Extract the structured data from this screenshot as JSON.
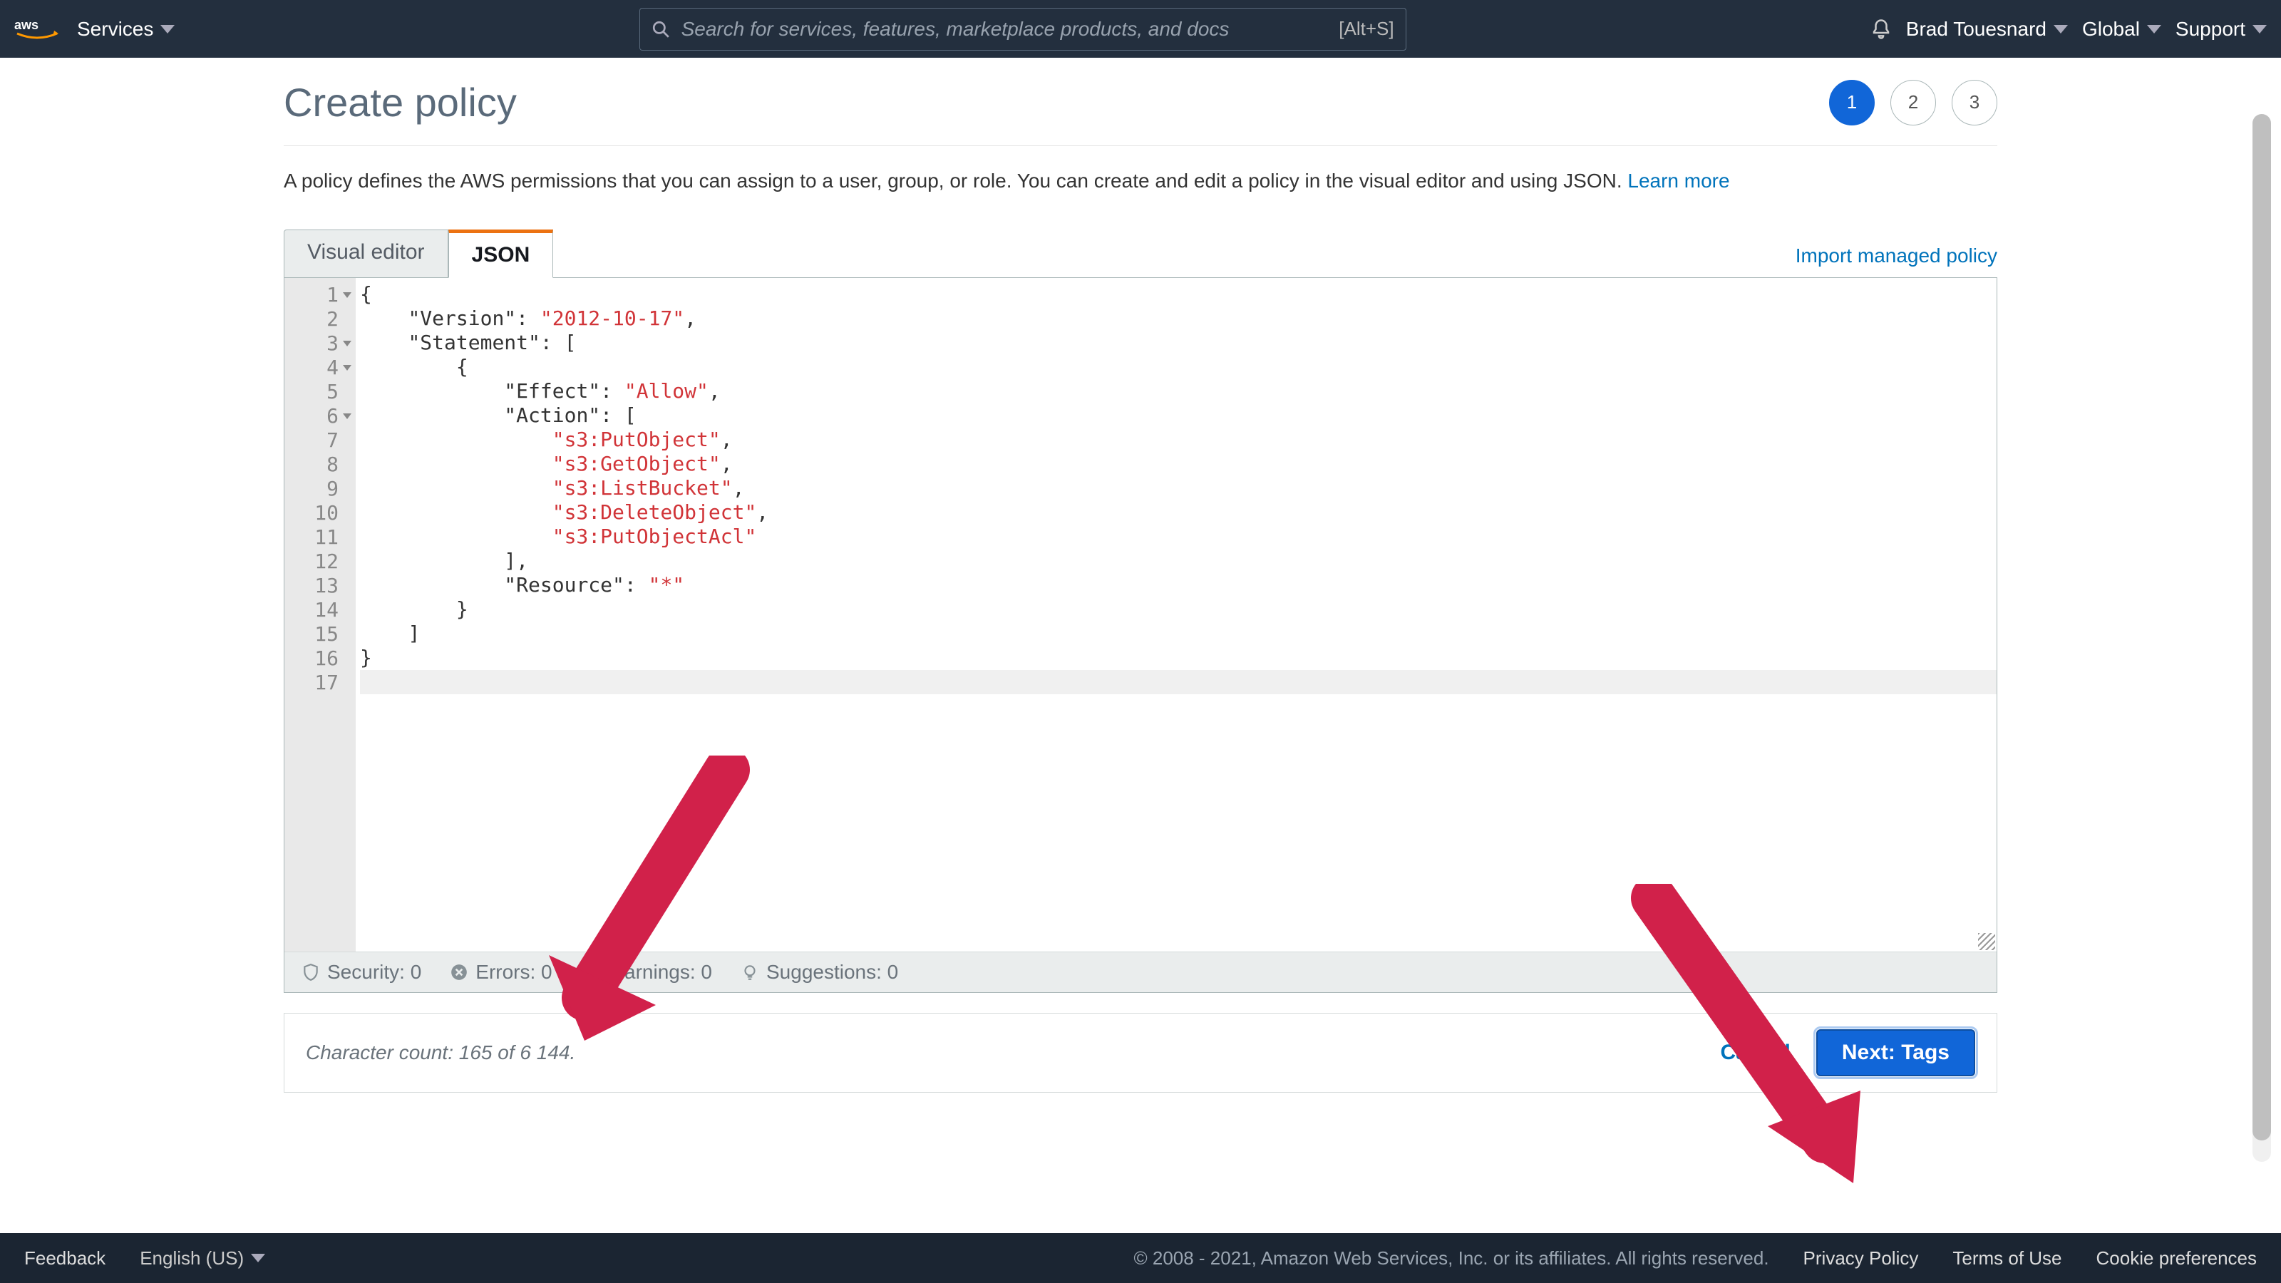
{
  "nav": {
    "services": "Services",
    "search_placeholder": "Search for services, features, marketplace products, and docs",
    "search_kbd": "[Alt+S]",
    "user": "Brad Touesnard",
    "region": "Global",
    "support": "Support"
  },
  "page": {
    "title": "Create policy",
    "desc_pre": "A policy defines the AWS permissions that you can assign to a user, group, or role. You can create and edit a policy in the visual editor and using JSON. ",
    "learn_more": "Learn more"
  },
  "steps": [
    "1",
    "2",
    "3"
  ],
  "tabs": {
    "visual": "Visual editor",
    "json": "JSON"
  },
  "import_link": "Import managed policy",
  "code": {
    "lines": [
      {
        "n": 1,
        "fold": true,
        "html": "{"
      },
      {
        "n": 2,
        "fold": false,
        "html": "    <span class='s-k'>\"Version\"</span><span class='s-p'>: </span><span class='s-str'>\"2012-10-17\"</span><span class='s-p'>,</span>"
      },
      {
        "n": 3,
        "fold": true,
        "html": "    <span class='s-k'>\"Statement\"</span><span class='s-p'>: [</span>"
      },
      {
        "n": 4,
        "fold": true,
        "html": "        <span class='s-p'>{</span>"
      },
      {
        "n": 5,
        "fold": false,
        "html": "            <span class='s-k'>\"Effect\"</span><span class='s-p'>: </span><span class='s-str'>\"Allow\"</span><span class='s-p'>,</span>"
      },
      {
        "n": 6,
        "fold": true,
        "html": "            <span class='s-k'>\"Action\"</span><span class='s-p'>: [</span>"
      },
      {
        "n": 7,
        "fold": false,
        "html": "                <span class='s-str'>\"s3:PutObject\"</span><span class='s-p'>,</span>"
      },
      {
        "n": 8,
        "fold": false,
        "html": "                <span class='s-str'>\"s3:GetObject\"</span><span class='s-p'>,</span>"
      },
      {
        "n": 9,
        "fold": false,
        "html": "                <span class='s-str'>\"s3:ListBucket\"</span><span class='s-p'>,</span>"
      },
      {
        "n": 10,
        "fold": false,
        "html": "                <span class='s-str'>\"s3:DeleteObject\"</span><span class='s-p'>,</span>"
      },
      {
        "n": 11,
        "fold": false,
        "html": "                <span class='s-str'>\"s3:PutObjectAcl\"</span>"
      },
      {
        "n": 12,
        "fold": false,
        "html": "            <span class='s-p'>],</span>"
      },
      {
        "n": 13,
        "fold": false,
        "html": "            <span class='s-k'>\"Resource\"</span><span class='s-p'>: </span><span class='s-str'>\"*\"</span>"
      },
      {
        "n": 14,
        "fold": false,
        "html": "        <span class='s-p'>}</span>"
      },
      {
        "n": 15,
        "fold": false,
        "html": "    <span class='s-p'>]</span>"
      },
      {
        "n": 16,
        "fold": false,
        "html": "<span class='s-p'>}</span>"
      },
      {
        "n": 17,
        "fold": false,
        "html": "",
        "hl": true
      }
    ]
  },
  "status": {
    "security": "Security: 0",
    "errors": "Errors: 0",
    "warnings": "Warnings: 0",
    "suggestions": "Suggestions: 0"
  },
  "action": {
    "char_count": "Character count: 165 of 6 144.",
    "cancel": "Cancel",
    "next": "Next: Tags"
  },
  "footer": {
    "feedback": "Feedback",
    "lang": "English (US)",
    "copyright": "© 2008 - 2021, Amazon Web Services, Inc. or its affiliates. All rights reserved.",
    "privacy": "Privacy Policy",
    "terms": "Terms of Use",
    "cookies": "Cookie preferences"
  }
}
